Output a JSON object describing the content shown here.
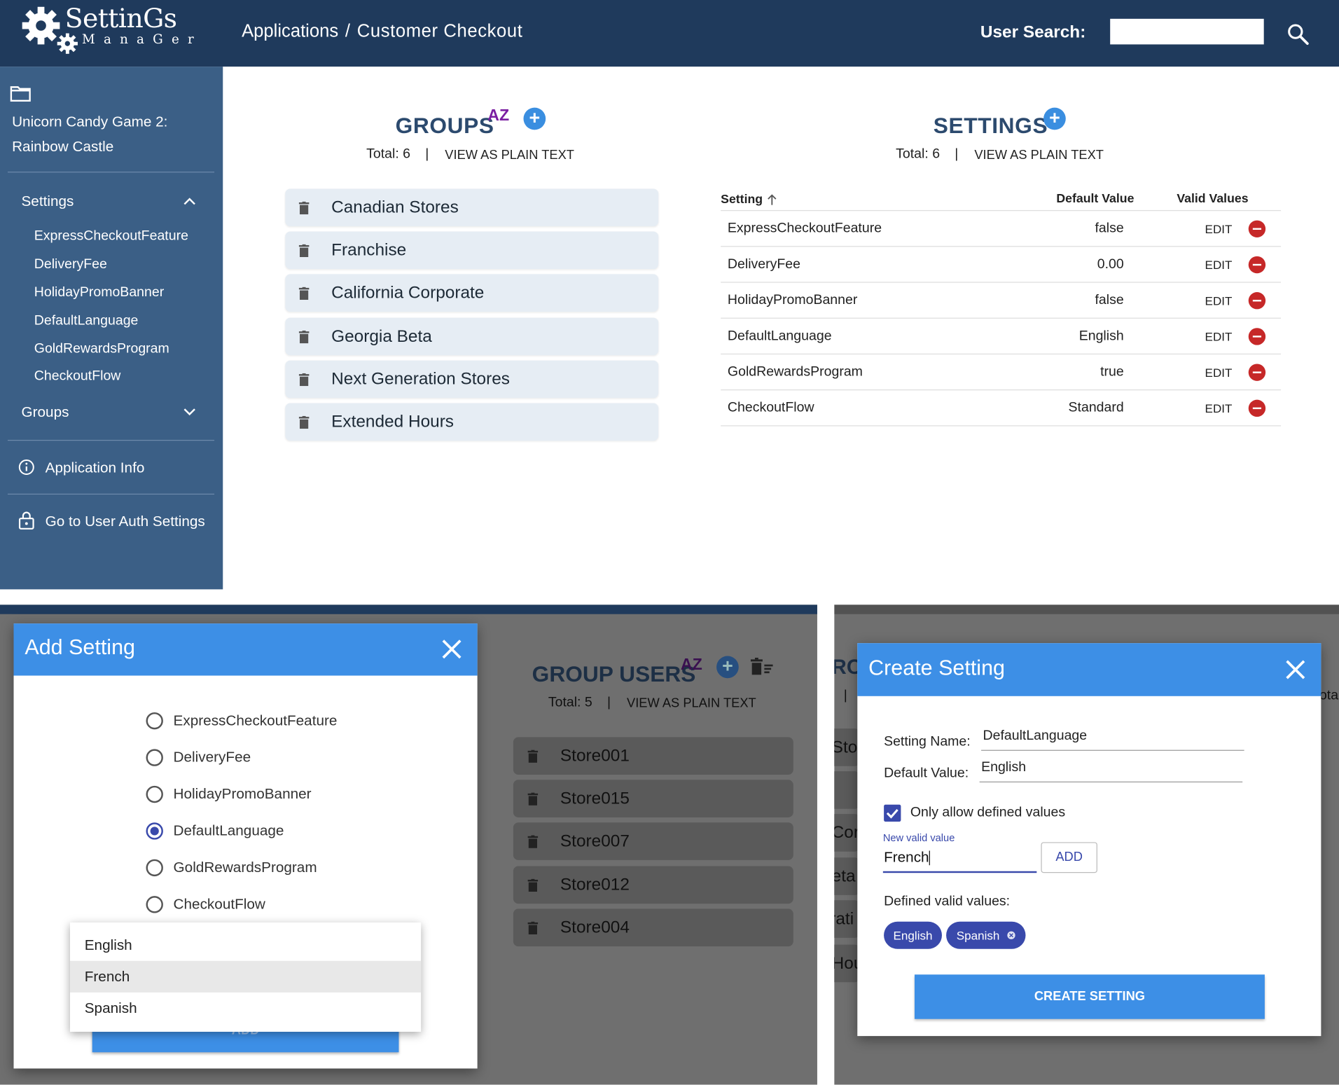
{
  "header": {
    "logo_main": "SettinGs",
    "logo_sub": "ManaGer",
    "breadcrumb_root": "Applications",
    "breadcrumb_sep": "/",
    "breadcrumb_current": "Customer Checkout",
    "user_search_label": "User Search:",
    "user_search_value": ""
  },
  "sidebar": {
    "app_name_line1": "Unicorn Candy Game 2:",
    "app_name_line2": "Rainbow Castle",
    "settings_heading": "Settings",
    "settings_items": [
      "ExpressCheckoutFeature",
      "DeliveryFee",
      "HolidayPromoBanner",
      "DefaultLanguage",
      "GoldRewardsProgram",
      "CheckoutFlow"
    ],
    "groups_heading": "Groups",
    "app_info": "Application Info",
    "user_auth": "Go to User Auth Settings"
  },
  "groups": {
    "title": "GROUPS",
    "sort_icon_text": "AZ",
    "total_label": "Total: 6",
    "divider": "|",
    "plain_text_link": "VIEW AS PLAIN TEXT",
    "items": [
      "Canadian Stores",
      "Franchise",
      "California Corporate",
      "Georgia Beta",
      "Next Generation Stores",
      "Extended Hours"
    ]
  },
  "settings": {
    "title": "SETTINGS",
    "total_label": "Total: 6",
    "divider": "|",
    "plain_text_link": "VIEW AS PLAIN TEXT",
    "columns": {
      "setting": "Setting",
      "default": "Default Value",
      "valid": "Valid Values"
    },
    "rows": [
      {
        "name": "ExpressCheckoutFeature",
        "value": "false",
        "action": "EDIT"
      },
      {
        "name": "DeliveryFee",
        "value": "0.00",
        "action": "EDIT"
      },
      {
        "name": "HolidayPromoBanner",
        "value": "false",
        "action": "EDIT"
      },
      {
        "name": "DefaultLanguage",
        "value": "English",
        "action": "EDIT"
      },
      {
        "name": "GoldRewardsProgram",
        "value": "true",
        "action": "EDIT"
      },
      {
        "name": "CheckoutFlow",
        "value": "Standard",
        "action": "EDIT"
      }
    ]
  },
  "add_setting_dialog": {
    "title": "Add Setting",
    "options": [
      "ExpressCheckoutFeature",
      "DeliveryFee",
      "HolidayPromoBanner",
      "DefaultLanguage",
      "GoldRewardsProgram",
      "CheckoutFlow"
    ],
    "selected_option": "DefaultLanguage",
    "dropdown_options": [
      "English",
      "French",
      "Spanish"
    ],
    "dropdown_highlighted": "French",
    "add_button_label": "ADD"
  },
  "group_users": {
    "title": "GROUP USERS",
    "sort_icon_text": "AZ",
    "total_label": "Total: 5",
    "divider": "|",
    "plain_text_link": "VIEW AS PLAIN TEXT",
    "items": [
      "Store001",
      "Store015",
      "Store007",
      "Store012",
      "Store004"
    ]
  },
  "background_fragments": {
    "title_fragment": "RO",
    "divider": "|",
    "total_fragment": "ota",
    "row_fragments": [
      "Stor",
      "Cor",
      "eta",
      "rati",
      "Hou"
    ]
  },
  "create_setting_dialog": {
    "title": "Create Setting",
    "name_label": "Setting Name:",
    "name_value": "DefaultLanguage",
    "default_label": "Default Value:",
    "default_value": "English",
    "checkbox_label": "Only allow defined values",
    "checkbox_checked": true,
    "new_value_label": "New valid value",
    "new_value": "French",
    "add_button_label": "ADD",
    "defined_values_label": "Defined valid values:",
    "chips": [
      "English",
      "Spanish"
    ],
    "submit_label": "CREATE SETTING"
  },
  "colors": {
    "header_bg": "#1f3a5c",
    "sidebar_bg": "#3b5f86",
    "accent_blue": "#3d8fe6",
    "chip_indigo": "#3949ab",
    "delete_red": "#c62828"
  }
}
